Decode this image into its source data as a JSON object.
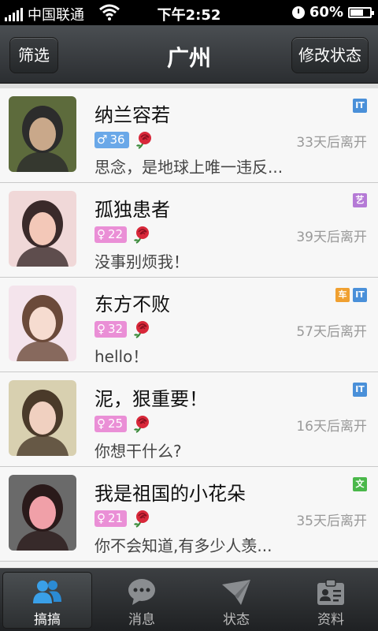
{
  "status_bar": {
    "carrier": "中国联通",
    "time": "下午2:52",
    "battery": "60%",
    "battery_level": 0.6
  },
  "header": {
    "title": "广州",
    "filter_label": "筛选",
    "edit_status_label": "修改状态"
  },
  "users": [
    {
      "name": "纳兰容若",
      "gender": "male",
      "gender_symbol": "♂",
      "age": "36",
      "signature": "思念，是地球上唯一违反...",
      "leave_time": "33天后离开",
      "tags": [
        {
          "text": "IT",
          "color": "#4a90d9"
        }
      ],
      "avatar_colors": [
        "#5d6b3c",
        "#2c2c2c",
        "#c9a88a"
      ]
    },
    {
      "name": "孤独患者",
      "gender": "female",
      "gender_symbol": "♀",
      "age": "22",
      "signature": "没事别烦我！",
      "leave_time": "39天后离开",
      "tags": [
        {
          "text": "艺",
          "color": "#b57ad6"
        }
      ],
      "avatar_colors": [
        "#f0d8d8",
        "#3a2a2a",
        "#f3c8b8"
      ]
    },
    {
      "name": "东方不败",
      "gender": "female",
      "gender_symbol": "♀",
      "age": "32",
      "signature": "hello！",
      "leave_time": "57天后离开",
      "tags": [
        {
          "text": "车",
          "color": "#f0a030"
        },
        {
          "text": "IT",
          "color": "#4a90d9"
        }
      ],
      "avatar_colors": [
        "#f4e4ec",
        "#6b4a3a",
        "#f6dcd0"
      ]
    },
    {
      "name": "泥，狠重要！",
      "gender": "female",
      "gender_symbol": "♀",
      "age": "25",
      "signature": "你想干什么?",
      "leave_time": "16天后离开",
      "tags": [
        {
          "text": "IT",
          "color": "#4a90d9"
        }
      ],
      "avatar_colors": [
        "#d8d0b0",
        "#4a3a2a",
        "#f0d0c0"
      ]
    },
    {
      "name": "我是祖国的小花朵",
      "gender": "female",
      "gender_symbol": "♀",
      "age": "21",
      "signature": "你不会知道,有多少人羡...",
      "leave_time": "35天后离开",
      "tags": [
        {
          "text": "文",
          "color": "#4ab84a"
        }
      ],
      "avatar_colors": [
        "#6a6a6a",
        "#2a1a1a",
        "#f0a0a8"
      ]
    }
  ],
  "tabs": [
    {
      "label": "搞搞",
      "icon": "people-icon",
      "active": true
    },
    {
      "label": "消息",
      "icon": "chat-bubble-icon",
      "active": false
    },
    {
      "label": "状态",
      "icon": "paper-plane-icon",
      "active": false
    },
    {
      "label": "资料",
      "icon": "profile-card-icon",
      "active": false
    }
  ]
}
